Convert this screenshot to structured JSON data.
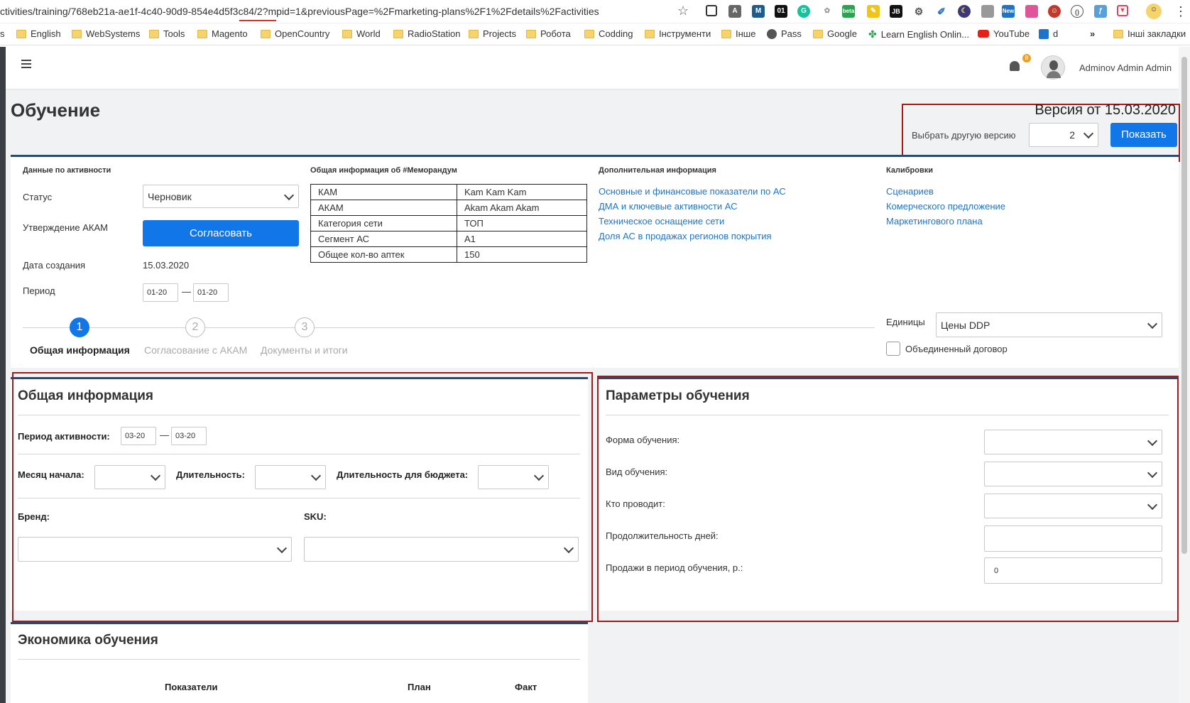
{
  "browser": {
    "url": "ctivities/training/768eb21a-ae1f-4c40-90d9-854e4d5f3c84/2?mpid=1&previousPage=%2Fmarketing-plans%2F1%2Fdetails%2Factivities",
    "bookmarks": [
      "s",
      "English",
      "WebSystems",
      "Tools",
      "Magento",
      "OpenCountry",
      "World",
      "RadioStation",
      "Projects",
      "Робота",
      "Codding",
      "Інструменти",
      "Інше",
      "Pass",
      "Google",
      "Learn English Onlin...",
      "YouTube",
      "d",
      "»",
      "Інші закладки"
    ]
  },
  "header": {
    "menu_icon": "hamburger-icon",
    "user_name": "Adminov Admin Admin",
    "notification_badge": "8"
  },
  "page": {
    "title": "Обучение"
  },
  "version": {
    "title": "Версия от 15.03.2020",
    "label": "Выбрать другую версию",
    "selected": "2",
    "show_button": "Показать"
  },
  "activity": {
    "section_title": "Данные по активности",
    "status_label": "Статус",
    "status_value": "Черновик",
    "approve_label": "Утверждение АКАМ",
    "approve_button": "Согласовать",
    "created_label": "Дата создания",
    "created_value": "15.03.2020",
    "period_label": "Период",
    "period_from": "01-20",
    "period_to": "01-20",
    "dash": "—"
  },
  "memo": {
    "section_title": "Общая информация об #Меморандум",
    "rows": [
      {
        "key": "КАМ",
        "value": "Kam Kam Kam"
      },
      {
        "key": "АКАМ",
        "value": "Akam Akam Akam"
      },
      {
        "key": "Категория сети",
        "value": "ТОП"
      },
      {
        "key": "Сегмент АС",
        "value": "A1"
      },
      {
        "key": "Общее кол-во аптек",
        "value": "150"
      }
    ]
  },
  "additional": {
    "section_title": "Дополнительная информация",
    "links": [
      "Основные и финансовые показатели по АС",
      "ДМА и ключевые активности АС",
      "Техническое оснащение сети",
      "Доля АС в продажах регионов покрытия"
    ]
  },
  "calibrations": {
    "section_title": "Калибровки",
    "links": [
      "Сценариев",
      "Комерческого предложение",
      "Маркетингового плана"
    ]
  },
  "steps": [
    {
      "number": "1",
      "label": "Общая информация"
    },
    {
      "number": "2",
      "label": "Согласование с АКАМ"
    },
    {
      "number": "3",
      "label": "Документы и итоги"
    }
  ],
  "units": {
    "label": "Единицы",
    "value": "Цены DDP",
    "combined_label": "Объединенный договор"
  },
  "general": {
    "title": "Общая информация",
    "period_label": "Период активности:",
    "period_from": "03-20",
    "period_to": "03-20",
    "dash": "—",
    "start_month_label": "Месяц начала:",
    "duration_label": "Длительность:",
    "budget_duration_label": "Длительность для бюджета:",
    "brand_label": "Бренд:",
    "sku_label": "SKU:"
  },
  "params": {
    "title": "Параметры обучения",
    "form_label": "Форма обучения:",
    "type_label": "Вид обучения:",
    "who_label": "Кто проводит:",
    "days_label": "Продолжительность дней:",
    "sales_label": "Продажи в период обучения, р.:",
    "sales_value": "0"
  },
  "economics": {
    "title": "Экономика обучения",
    "col_indicators": "Показатели",
    "col_plan": "План",
    "col_fact": "Факт"
  }
}
